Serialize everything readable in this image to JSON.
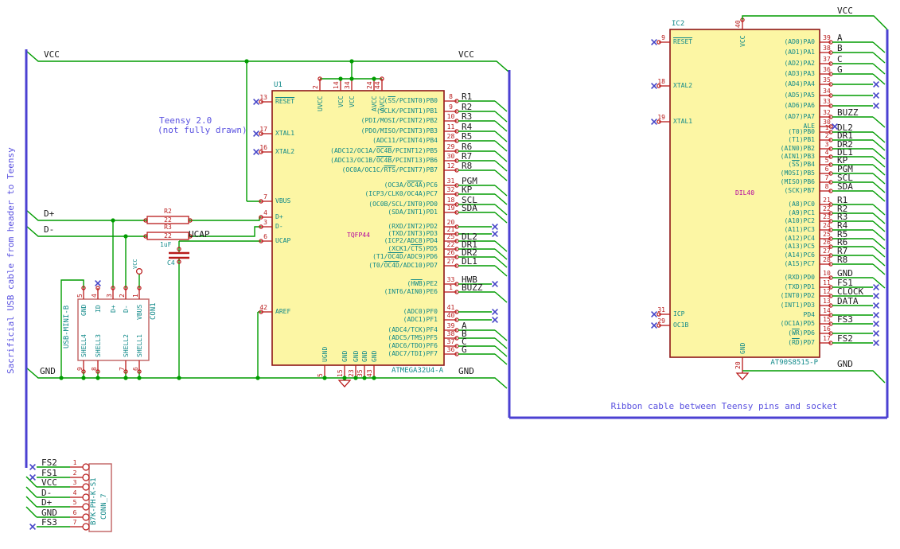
{
  "notes": {
    "cable": "Sacrificial USB cable from header to Teensy",
    "teensy1": "Teensy 2.0",
    "teensy2": "(not fully drawn)",
    "ribbon": "Ribbon cable between Teensy pins and socket"
  },
  "labels": {
    "vcc_left": "VCC",
    "vcc_u1": "VCC",
    "gnd_left": "GND",
    "gnd_u1": "GND",
    "dplus": "D+",
    "dminus": "D-",
    "ucap": "UCAP",
    "vcc_ic2": "VCC",
    "gnd_ic2": "GND"
  },
  "u1": {
    "ref": "U1",
    "value": "ATMEGA32U4-A",
    "package": "TQFP44",
    "top_pins": [
      {
        "num": "2",
        "name": "UVCC"
      },
      {
        "num": "14",
        "name": "VCC"
      },
      {
        "num": "34",
        "name": "VCC"
      },
      {
        "num": "24",
        "name": "AVCC"
      },
      {
        "num": "44",
        "name": "AVCC"
      }
    ],
    "bottom_pins": [
      {
        "num": "5",
        "name": "UGND"
      },
      {
        "num": "15",
        "name": "GND"
      },
      {
        "num": "23",
        "name": "GND"
      },
      {
        "num": "35",
        "name": "GND"
      },
      {
        "num": "43",
        "name": "GND"
      }
    ],
    "left_pins": [
      {
        "num": "13",
        "name": "~RESET~",
        "conn": "nc"
      },
      {
        "num": "17",
        "name": "XTAL1",
        "conn": "nc"
      },
      {
        "num": "16",
        "name": "XTAL2",
        "conn": "nc"
      },
      {
        "num": "7",
        "name": "VBUS",
        "conn": "wire"
      },
      {
        "num": "4",
        "name": "D+",
        "conn": "wire"
      },
      {
        "num": "3",
        "name": "D-",
        "conn": "wire"
      },
      {
        "num": "6",
        "name": "UCAP",
        "conn": "wire"
      },
      {
        "num": "42",
        "name": "AREF",
        "conn": "wire"
      }
    ],
    "right_pins": [
      {
        "num": "8",
        "name": "(~SS~/PCINT0)PB0",
        "label": "R1",
        "conn": "bus"
      },
      {
        "num": "9",
        "name": "(SCLK/PCINT1)PB1",
        "label": "R2",
        "conn": "bus"
      },
      {
        "num": "10",
        "name": "(PDI/MOSI/PCINT2)PB2",
        "label": "R3",
        "conn": "bus"
      },
      {
        "num": "11",
        "name": "(PDO/MISO/PCINT3)PB3",
        "label": "R4",
        "conn": "bus"
      },
      {
        "num": "28",
        "name": "(ADC11/PCINT4)PB4",
        "label": "R5",
        "conn": "bus"
      },
      {
        "num": "29",
        "name": "(ADC12/OC1A/~OC4B~/PCINT12)PB5",
        "label": "R6",
        "conn": "bus"
      },
      {
        "num": "30",
        "name": "(ADC13/OC1B/~OC4B~/PCINT13)PB6",
        "label": "R7",
        "conn": "bus"
      },
      {
        "num": "12",
        "name": "(OC0A/OC1C/~RTS~/PCINT7)PB7",
        "label": "R8",
        "conn": "bus"
      },
      {
        "num": "31",
        "name": "(OC3A/~OC4A~)PC6",
        "label": "PGM",
        "conn": "bus"
      },
      {
        "num": "32",
        "name": "(ICP3/CLK0/OC4A)PC7",
        "label": "KP",
        "conn": "bus"
      },
      {
        "num": "18",
        "name": "(OC0B/SCL/INT0)PD0",
        "label": "SCL",
        "conn": "bus"
      },
      {
        "num": "19",
        "name": "(SDA/INT1)PD1",
        "label": "SDA",
        "conn": "bus"
      },
      {
        "num": "20",
        "name": "(RXD/INT2)PD2",
        "label": "",
        "conn": "nc"
      },
      {
        "num": "21",
        "name": "(TXD/INT3)PD3",
        "label": "",
        "conn": "nc"
      },
      {
        "num": "25",
        "name": "(ICP2/ADC8)PD4",
        "label": "DL2",
        "conn": "bus"
      },
      {
        "num": "22",
        "name": "(XCK1/~CTS~)PD5",
        "label": "DR1",
        "conn": "bus"
      },
      {
        "num": "26",
        "name": "(T1/~OC4D~/ADC9)PD6",
        "label": "DR2",
        "conn": "bus"
      },
      {
        "num": "27",
        "name": "(T0/~OC4D~/ADC10)PD7",
        "label": "DL1",
        "conn": "bus"
      },
      {
        "num": "33",
        "name": "(~HWB~)PE2",
        "label": "HWB",
        "conn": "nc"
      },
      {
        "num": "1",
        "name": "(INT6/AIN0)PE6",
        "label": "BUZZ",
        "conn": "bus"
      },
      {
        "num": "41",
        "name": "(ADC0)PF0",
        "label": "",
        "conn": "nc"
      },
      {
        "num": "40",
        "name": "(ADC1)PF1",
        "label": "",
        "conn": "nc"
      },
      {
        "num": "39",
        "name": "(ADC4/TCK)PF4",
        "label": "A",
        "conn": "bus"
      },
      {
        "num": "38",
        "name": "(ADC5/TMS)PF5",
        "label": "B",
        "conn": "bus"
      },
      {
        "num": "37",
        "name": "(ADC6/TDO)PF6",
        "label": "C",
        "conn": "bus"
      },
      {
        "num": "36",
        "name": "(ADC7/TDI)PF7",
        "label": "G",
        "conn": "bus"
      }
    ]
  },
  "ic2": {
    "ref": "IC2",
    "value": "AT90S8515-P",
    "package": "DIL40",
    "top_pin": {
      "num": "40",
      "name": "VCC"
    },
    "bottom_pin": {
      "num": "20",
      "name": "GND"
    },
    "left_pins": [
      {
        "num": "9",
        "name": "~RESET~",
        "conn": "nc"
      },
      {
        "num": "18",
        "name": "XTAL2",
        "conn": "nc"
      },
      {
        "num": "19",
        "name": "XTAL1",
        "conn": "nc"
      },
      {
        "num": "31",
        "name": "ICP",
        "conn": "nc"
      },
      {
        "num": "29",
        "name": "OC1B",
        "conn": "nc"
      }
    ],
    "right_pins": [
      {
        "num": "39",
        "name": "(AD0)PA0",
        "label": "A",
        "conn": "bus"
      },
      {
        "num": "38",
        "name": "(AD1)PA1",
        "label": "B",
        "conn": "bus"
      },
      {
        "num": "37",
        "name": "(AD2)PA2",
        "label": "C",
        "conn": "bus"
      },
      {
        "num": "36",
        "name": "(AD3)PA3",
        "label": "G",
        "conn": "bus"
      },
      {
        "num": "35",
        "name": "(AD4)PA4",
        "label": "",
        "conn": "nc"
      },
      {
        "num": "34",
        "name": "(AD5)PA5",
        "label": "",
        "conn": "nc"
      },
      {
        "num": "33",
        "name": "(AD6)PA6",
        "label": "",
        "conn": "nc"
      },
      {
        "num": "32",
        "name": "(AD7)PA7",
        "label": "BUZZ",
        "conn": "bus"
      },
      {
        "num": "30",
        "name": "ALE",
        "label": "",
        "conn": "ncstub"
      },
      {
        "num": "1",
        "name": "(T0)PB0",
        "label": "DL2",
        "conn": "bus"
      },
      {
        "num": "2",
        "name": "(T1)PB1",
        "label": "DR1",
        "conn": "bus"
      },
      {
        "num": "3",
        "name": "(AIN0)PB2",
        "label": "DR2",
        "conn": "bus"
      },
      {
        "num": "4",
        "name": "(AIN1)PB3",
        "label": "DL1",
        "conn": "bus"
      },
      {
        "num": "5",
        "name": "(~SS~)PB4",
        "label": "KP",
        "conn": "bus"
      },
      {
        "num": "6",
        "name": "(MOSI)PB5",
        "label": "PGM",
        "conn": "bus"
      },
      {
        "num": "7",
        "name": "(MISO)PB6",
        "label": "SCL",
        "conn": "bus"
      },
      {
        "num": "8",
        "name": "(SCK)PB7",
        "label": "SDA",
        "conn": "bus"
      },
      {
        "num": "21",
        "name": "(A8)PC0",
        "label": "R1",
        "conn": "bus"
      },
      {
        "num": "22",
        "name": "(A9)PC1",
        "label": "R2",
        "conn": "bus"
      },
      {
        "num": "23",
        "name": "(A10)PC2",
        "label": "R3",
        "conn": "bus"
      },
      {
        "num": "24",
        "name": "(A11)PC3",
        "label": "R4",
        "conn": "bus"
      },
      {
        "num": "25",
        "name": "(A12)PC4",
        "label": "R5",
        "conn": "bus"
      },
      {
        "num": "26",
        "name": "(A13)PC5",
        "label": "R6",
        "conn": "bus"
      },
      {
        "num": "27",
        "name": "(A14)PC6",
        "label": "R7",
        "conn": "bus"
      },
      {
        "num": "28",
        "name": "(A15)PC7",
        "label": "R8",
        "conn": "bus"
      },
      {
        "num": "10",
        "name": "(RXD)PD0",
        "label": "GND",
        "conn": "bus"
      },
      {
        "num": "11",
        "name": "(TXD)PD1",
        "label": "FS1",
        "conn": "nc"
      },
      {
        "num": "12",
        "name": "(INT0)PD2",
        "label": "CLOCK",
        "conn": "nc"
      },
      {
        "num": "13",
        "name": "(INT1)PD3",
        "label": "DATA",
        "conn": "nc"
      },
      {
        "num": "14",
        "name": "PD4",
        "label": "",
        "conn": "nc"
      },
      {
        "num": "15",
        "name": "(OC1A)PD5",
        "label": "FS3",
        "conn": "nc"
      },
      {
        "num": "16",
        "name": "(~WR~)PD6",
        "label": "",
        "conn": "nc"
      },
      {
        "num": "17",
        "name": "(~RD~)PD7",
        "label": "FS2",
        "conn": "nc"
      }
    ]
  },
  "usb": {
    "ref": "CON1",
    "value": "USB-MINI-B",
    "pins": [
      {
        "num": "5",
        "name": "GND"
      },
      {
        "num": "4",
        "name": "ID",
        "nc": true
      },
      {
        "num": "3",
        "name": "D+"
      },
      {
        "num": "2",
        "name": "D-"
      },
      {
        "num": "1",
        "name": "VBUS"
      }
    ],
    "shells": [
      {
        "num": "9",
        "name": "SHELL4"
      },
      {
        "num": "8",
        "name": "SHELL3"
      },
      {
        "num": "7",
        "name": "SHELL2"
      },
      {
        "num": "6",
        "name": "SHELL1"
      }
    ]
  },
  "conn7": {
    "part": "B7K-PH-K-S1",
    "name": "CONN_7",
    "rows": [
      {
        "num": "1",
        "label": "FS2",
        "conn": "nc"
      },
      {
        "num": "2",
        "label": "FS1",
        "conn": "nc"
      },
      {
        "num": "3",
        "label": "VCC",
        "conn": "cable"
      },
      {
        "num": "4",
        "label": "D-",
        "conn": "cable"
      },
      {
        "num": "5",
        "label": "D+",
        "conn": "cable"
      },
      {
        "num": "6",
        "label": "GND",
        "conn": "cable"
      },
      {
        "num": "7",
        "label": "FS3",
        "conn": "nc"
      }
    ]
  },
  "r2": {
    "ref": "R2",
    "value": "22"
  },
  "r3": {
    "ref": "R3",
    "value": "22"
  },
  "c4": {
    "ref": "C4",
    "value": "1uF"
  },
  "vcc_symbol": {
    "label": "VCC"
  },
  "colors": {
    "wire": "#009c00",
    "pin": "#b81a1a",
    "body_border": "#8e1616",
    "body_fill": "#fcf6a4",
    "conn_border": "#c06060",
    "pin_name": "#108989",
    "note": "#5a52e0",
    "cable": "#4b40d2",
    "nc": "#4646c8",
    "label": "#1b1b1b",
    "package": "#b2009f"
  }
}
